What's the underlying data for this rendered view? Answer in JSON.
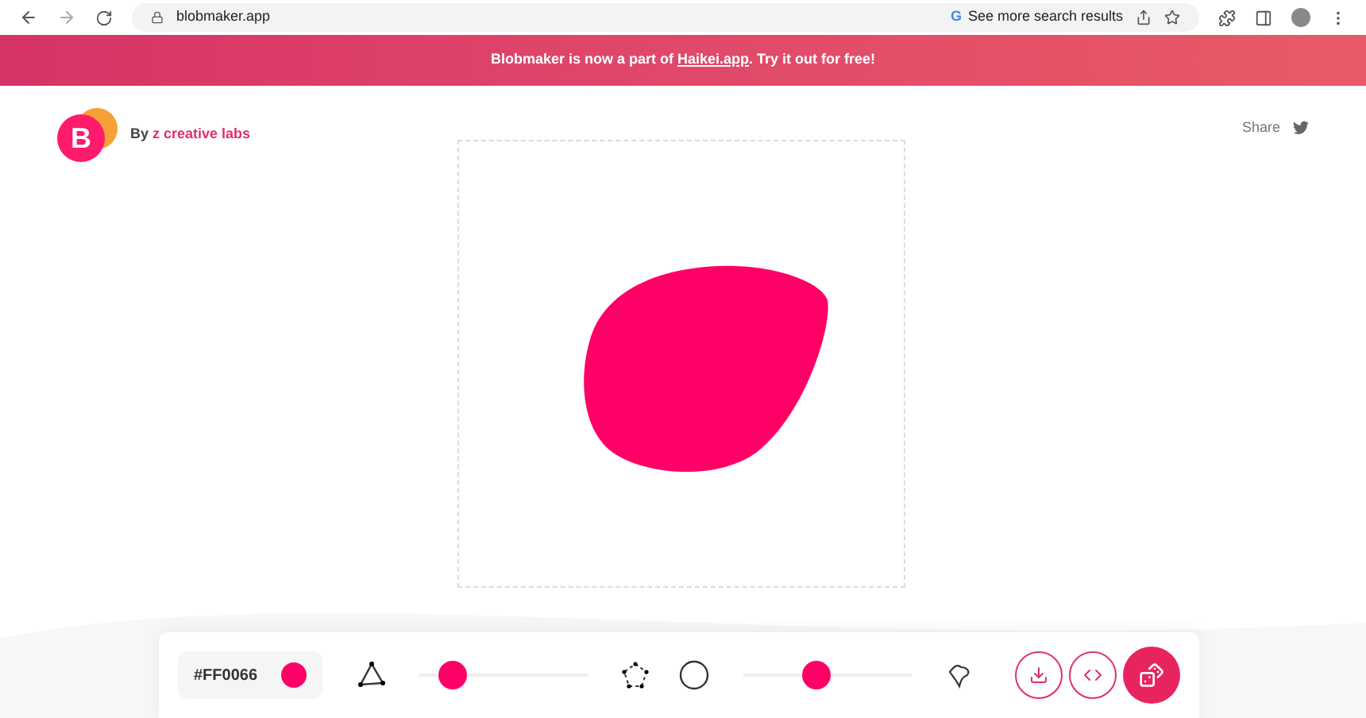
{
  "browser": {
    "url": "blobmaker.app",
    "search_chip_icon": "G",
    "search_chip": "See more search results"
  },
  "banner": {
    "before": "Blobmaker is now a part of ",
    "link": "Haikei.app",
    "after": ". Try it out for free!"
  },
  "header": {
    "logo_letter": "B",
    "by": "By ",
    "brand": "z creative labs",
    "share": "Share"
  },
  "toolbar": {
    "color_value": "#FF0066",
    "color": "#ff0066",
    "sliders": [
      {
        "level": 0.2
      },
      {
        "level": 0.43
      }
    ]
  }
}
